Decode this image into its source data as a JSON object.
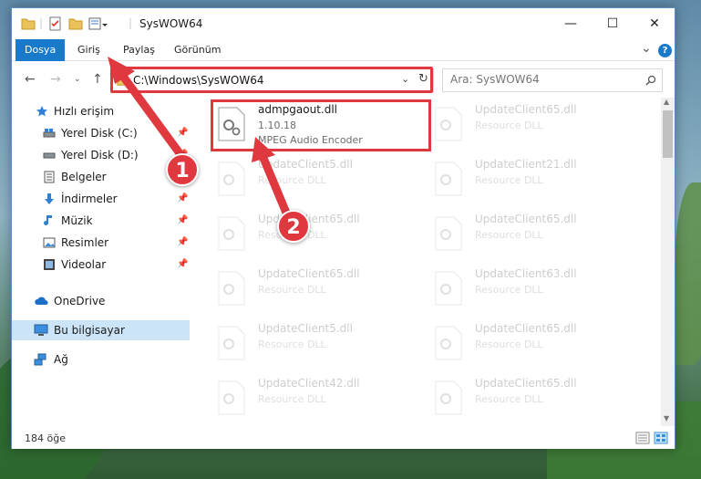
{
  "window": {
    "title": "SysWOW64",
    "minimize": "—",
    "maximize": "☐",
    "close": "✕"
  },
  "ribbon": {
    "tabs": [
      {
        "label": "Dosya",
        "active": true
      },
      {
        "label": "Giriş"
      },
      {
        "label": "Paylaş"
      },
      {
        "label": "Görünüm"
      }
    ],
    "help": "?",
    "expand": "⌄"
  },
  "address": {
    "path": "C:\\Windows\\SysWOW64",
    "search_placeholder": "Ara: SysWOW64"
  },
  "nav": {
    "quick_access": "Hızlı erişim",
    "items": [
      {
        "label": "Yerel Disk (C:)",
        "icon": "drive-icon",
        "pinned": true
      },
      {
        "label": "Yerel Disk (D:)",
        "icon": "drive-icon",
        "pinned": true
      },
      {
        "label": "Belgeler",
        "icon": "documents-icon",
        "pinned": true
      },
      {
        "label": "İndirmeler",
        "icon": "download-icon",
        "pinned": true
      },
      {
        "label": "Müzik",
        "icon": "music-icon",
        "pinned": true
      },
      {
        "label": "Resimler",
        "icon": "pictures-icon",
        "pinned": true
      },
      {
        "label": "Videolar",
        "icon": "videos-icon",
        "pinned": true
      }
    ],
    "onedrive": "OneDrive",
    "this_pc": "Bu bilgisayar",
    "network": "Ağ"
  },
  "files": [
    {
      "name": "admpgaout.dll",
      "version": "1.10.18",
      "desc": "MPEG Audio Encoder",
      "highlight": true
    },
    {
      "name": "UpdateClient65.dll",
      "desc": "Resource DLL"
    },
    {
      "name": "UpdateClient5.dll",
      "desc": "Resource DLL"
    },
    {
      "name": "UpdateClient21.dll",
      "desc": "Resource DLL"
    },
    {
      "name": "UpdateClient65.dll",
      "desc": "Resource DLL"
    },
    {
      "name": "UpdateClient65.dll",
      "desc": "Resource DLL"
    },
    {
      "name": "UpdateClient65.dll",
      "desc": "Resource DLL"
    },
    {
      "name": "UpdateClient63.dll",
      "desc": "Resource DLL"
    },
    {
      "name": "UpdateClient5.dll",
      "desc": "Resource DLL"
    },
    {
      "name": "UpdateClient65.dll",
      "desc": "Resource DLL"
    },
    {
      "name": "UpdateClient42.dll",
      "desc": "Resource DLL"
    },
    {
      "name": "UpdateClient65.dll",
      "desc": "Resource DLL"
    }
  ],
  "status": {
    "count": "184 öğe"
  },
  "callouts": [
    "1",
    "2"
  ],
  "colors": {
    "accent": "#1979ca",
    "highlight": "#e0383f",
    "selected": "#cce4f7"
  }
}
